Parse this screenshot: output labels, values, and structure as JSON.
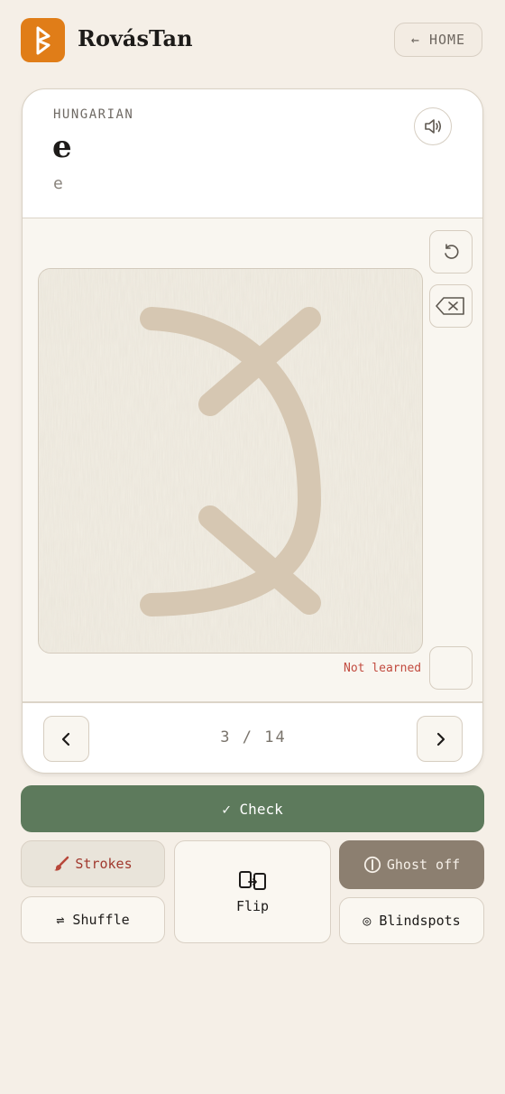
{
  "app": {
    "name": "RovásTan"
  },
  "header": {
    "home_label": "← HOME"
  },
  "card": {
    "language": "HUNGARIAN",
    "glyph": "e",
    "transliteration": "e",
    "status": "Not learned",
    "progress": {
      "current": 3,
      "total": 14,
      "text": "3 / 14"
    }
  },
  "actions": {
    "check": "✓ Check",
    "strokes": "Strokes",
    "flip": "Flip",
    "ghost": "Ghost off",
    "shuffle": "⇌ Shuffle",
    "blindspots": "◎ Blindspots"
  },
  "colors": {
    "accent": "#e07d18",
    "check_green": "#5d7a5c",
    "ghost_active": "#8c7f70",
    "strokes_active": "#e9e4da",
    "status_red": "#c24b3f",
    "ghost_stroke": "#d6c7b2"
  },
  "icons": {
    "logo": "rune-logo-icon",
    "sound": "speaker-icon",
    "undo": "undo-icon",
    "clear": "backspace-icon",
    "prev": "chevron-left-icon",
    "next": "chevron-right-icon",
    "brush": "brush-icon",
    "flip": "flip-cards-icon",
    "ghost": "ghost-toggle-icon"
  }
}
